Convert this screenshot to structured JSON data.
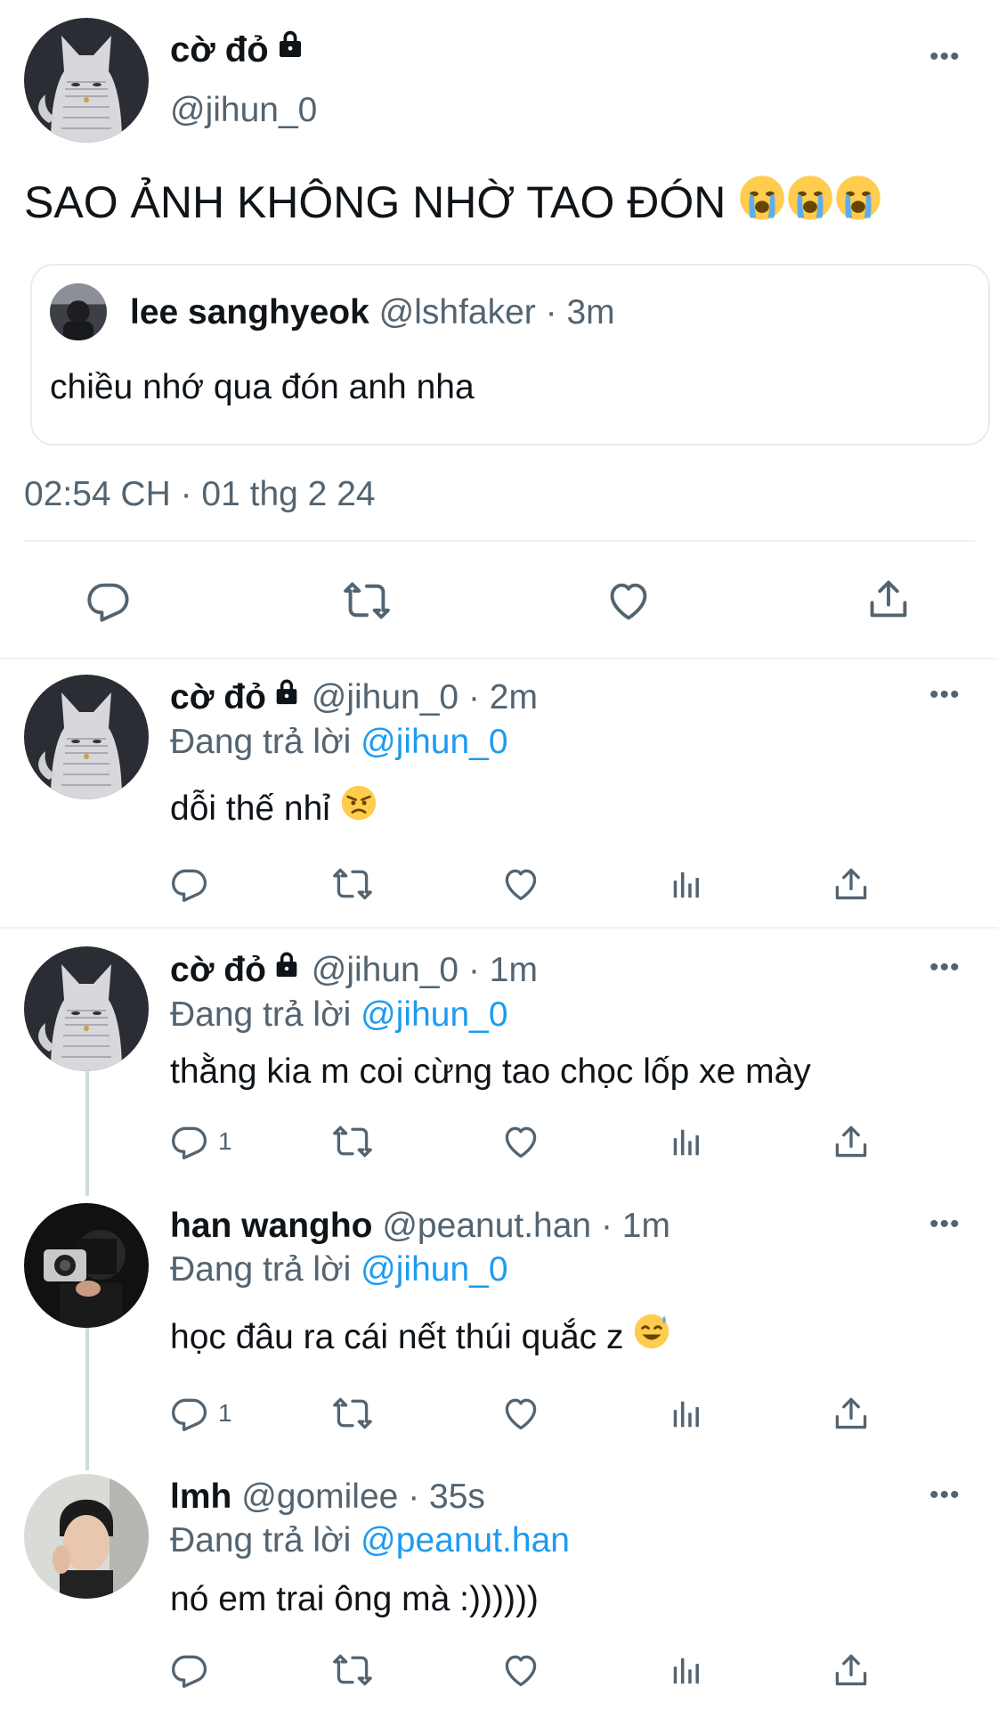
{
  "main_tweet": {
    "author_name": "cờ đỏ",
    "handle": "@jihun_0",
    "text": "SAO ẢNH KHÔNG NHỜ TAO ĐÓN",
    "timestamp": "02:54 CH · 01 thg 2 24",
    "quote": {
      "author_name": "lee sanghyeok",
      "meta": "@lshfaker · 3m",
      "text": "chiều nhớ qua đón anh nha"
    }
  },
  "replies": [
    {
      "author_name": "cờ đỏ",
      "meta": "@jihun_0 · 2m",
      "replying_prefix": "Đang trả lời",
      "replying_to": "@jihun_0",
      "text": "dỗi thế nhỉ",
      "reply_count": ""
    },
    {
      "author_name": "cờ đỏ",
      "meta": "@jihun_0 · 1m",
      "replying_prefix": "Đang trả lời",
      "replying_to": "@jihun_0",
      "text": "thằng kia m coi cừng tao chọc lốp xe mày",
      "reply_count": "1"
    },
    {
      "author_name": "han wangho",
      "meta": "@peanut.han · 1m",
      "replying_prefix": "Đang trả lời",
      "replying_to": "@jihun_0",
      "text": "học đâu ra cái nết thúi quắc z",
      "reply_count": "1"
    },
    {
      "author_name": "lmh",
      "meta": "@gomilee · 35s",
      "replying_prefix": "Đang trả lời",
      "replying_to": "@peanut.han",
      "text": "nó em trai ông mà :))))))",
      "reply_count": ""
    }
  ],
  "icons": {
    "more": "more-dots-icon",
    "lock": "lock-icon",
    "reply": "reply-icon",
    "retweet": "retweet-icon",
    "like": "heart-icon",
    "views": "views-icon",
    "share": "share-icon"
  },
  "colors": {
    "link": "#1d9bf0",
    "muted": "#536471",
    "text": "#0f1419",
    "divider": "#eff3f4"
  }
}
